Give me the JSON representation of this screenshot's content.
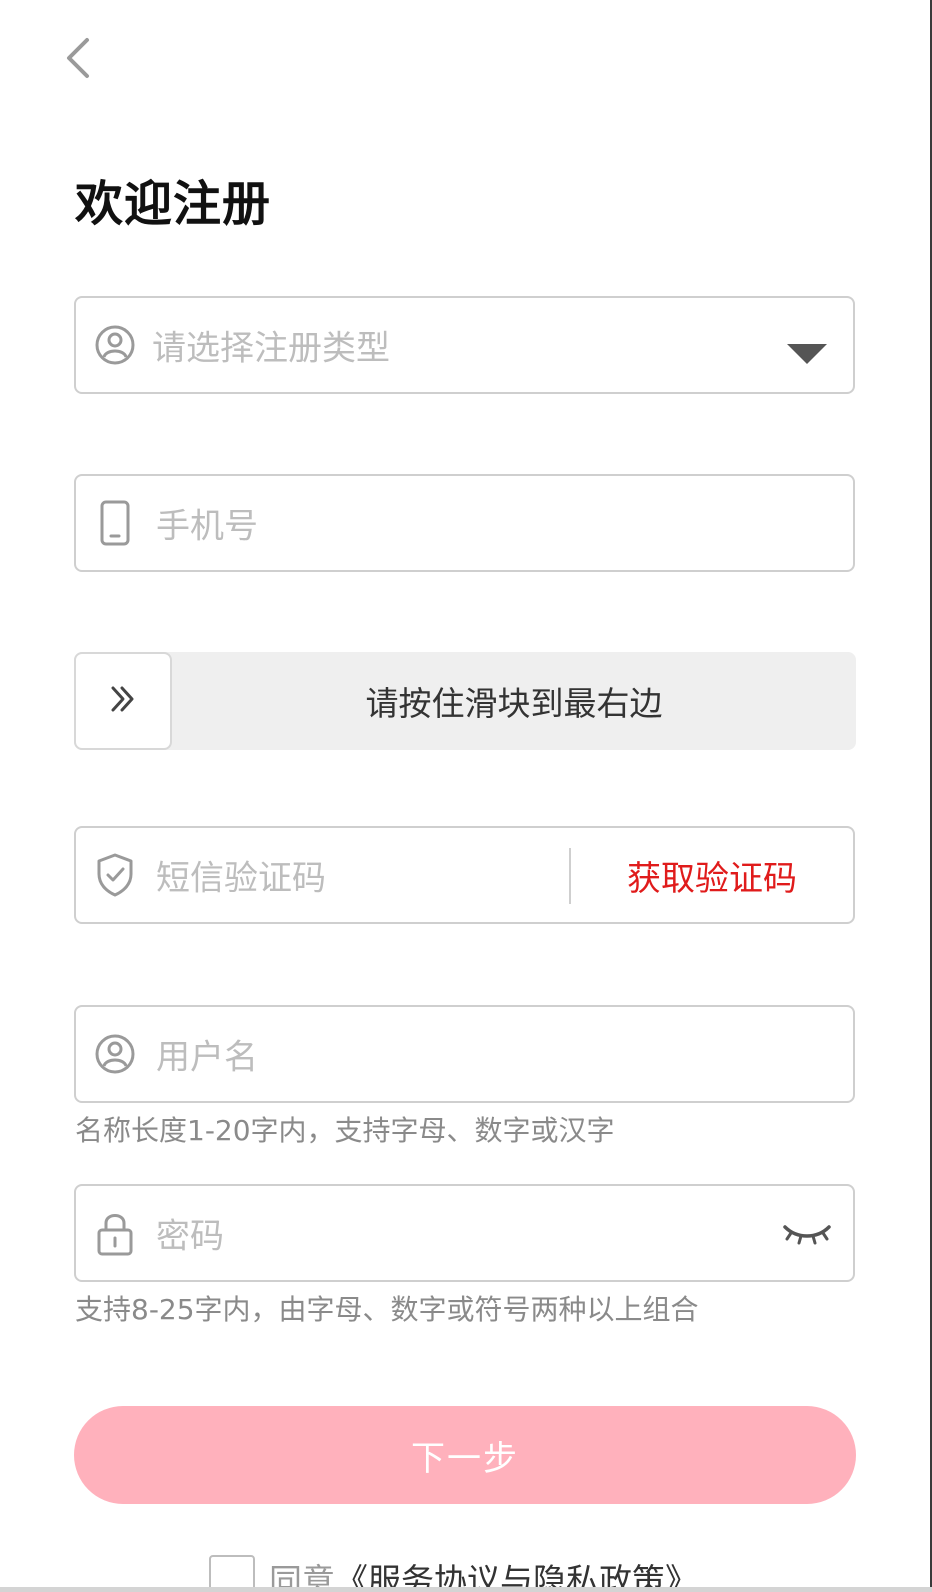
{
  "header": {
    "back_icon": "chevron-left-icon",
    "title": "欢迎注册"
  },
  "form": {
    "register_type": {
      "icon": "user-circle-icon",
      "placeholder": "请选择注册类型",
      "dropdown_icon": "caret-down-icon"
    },
    "phone": {
      "icon": "phone-icon",
      "placeholder": "手机号"
    },
    "slider": {
      "handle_icon": "double-chevron-right-icon",
      "label": "请按住滑块到最右边"
    },
    "sms_code": {
      "icon": "shield-check-icon",
      "placeholder": "短信验证码",
      "get_code_label": "获取验证码",
      "get_code_color": "#e01b1b"
    },
    "username": {
      "icon": "user-circle-icon",
      "placeholder": "用户名",
      "hint": "名称长度1-20字内，支持字母、数字或汉字"
    },
    "password": {
      "icon": "lock-icon",
      "placeholder": "密码",
      "toggle_icon": "eye-closed-icon",
      "hint": "支持8-25字内，由字母、数字或符号两种以上组合"
    }
  },
  "actions": {
    "next_label": "下一步",
    "next_color": "#ffb1bc"
  },
  "agreement": {
    "prefix": "同意",
    "link": "《服务协议与隐私政策》"
  }
}
